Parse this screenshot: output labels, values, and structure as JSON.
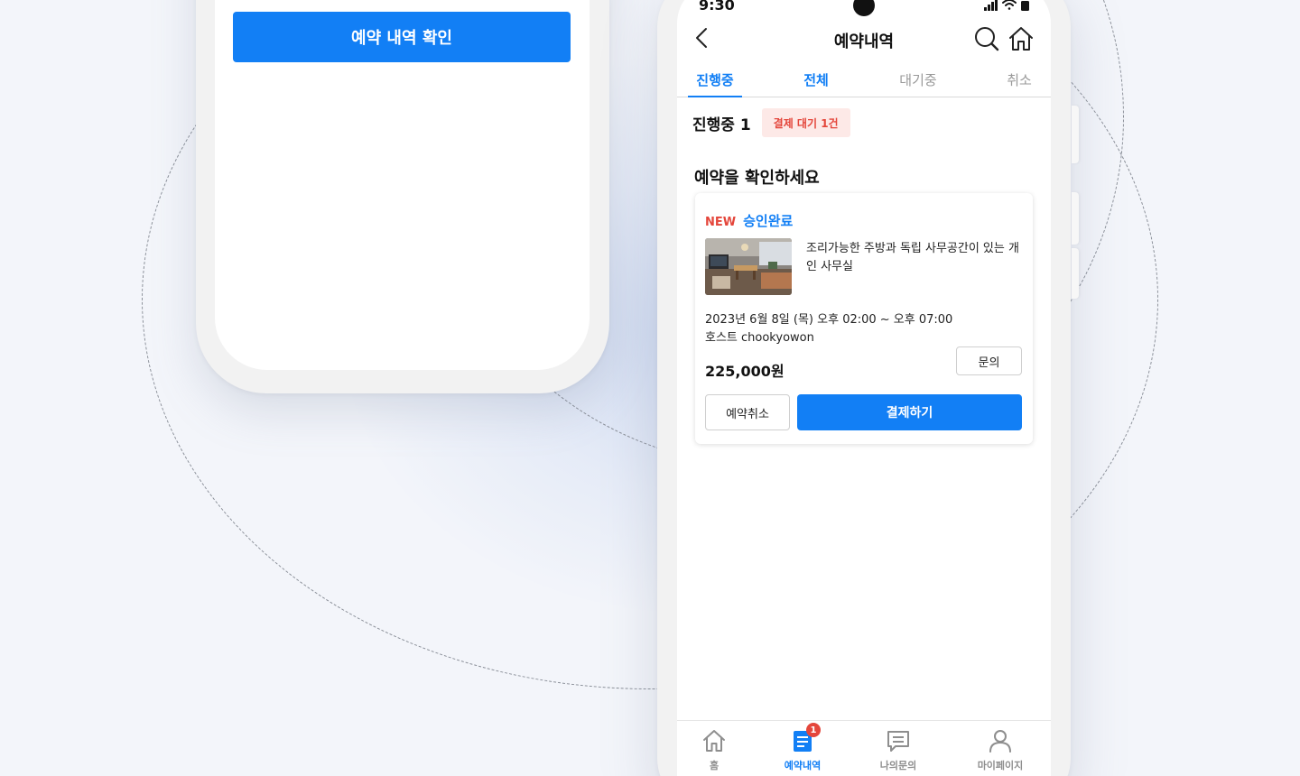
{
  "left_phone": {
    "confirm_button": "예약 내역 확인"
  },
  "status_bar": {
    "time": "9:30"
  },
  "header": {
    "title": "예약내역"
  },
  "tabs": [
    {
      "label": "진행중",
      "state": "active"
    },
    {
      "label": "전체",
      "state": "highlight"
    },
    {
      "label": "대기중",
      "state": "inactive"
    },
    {
      "label": "취소",
      "state": "inactive"
    }
  ],
  "summary": {
    "label": "진행중 1",
    "badge": "결제 대기 1건"
  },
  "section_title": "예약을 확인하세요",
  "booking_card": {
    "new_tag": "NEW",
    "status": "승인완료",
    "description": "조리가능한 주방과 독립 사무공간이 있는 개인 사무실",
    "date": "2023년 6월 8일 (목) 오후 02:00 ~ 오후 07:00",
    "host": "호스트 chookyowon",
    "price": "225,000원",
    "inquiry_button": "문의",
    "cancel_button": "예약취소",
    "pay_button": "결제하기"
  },
  "bottom_nav": [
    {
      "label": "홈",
      "icon": "home-icon"
    },
    {
      "label": "예약내역",
      "icon": "document-icon",
      "badge": "1"
    },
    {
      "label": "나의문의",
      "icon": "chat-icon"
    },
    {
      "label": "마이페이지",
      "icon": "person-icon"
    }
  ],
  "colors": {
    "accent": "#127ff5",
    "alert": "#e4463b",
    "badge_bg": "#fde9e7",
    "background": "#f3f5fa"
  }
}
